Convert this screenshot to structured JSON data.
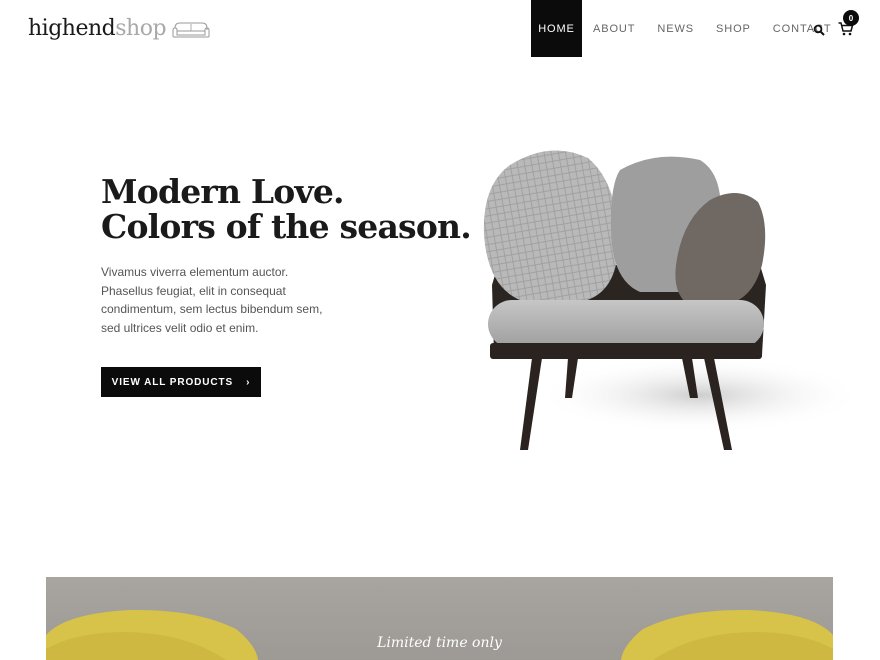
{
  "logo": {
    "part1": "highend",
    "part2": "shop",
    "icon": "sofa-outline-icon"
  },
  "nav": {
    "items": [
      {
        "label": "HOME",
        "active": true
      },
      {
        "label": "ABOUT",
        "active": false
      },
      {
        "label": "NEWS",
        "active": false
      },
      {
        "label": "SHOP",
        "active": false
      },
      {
        "label": "CONTACT",
        "active": false
      }
    ],
    "search_icon": "search-icon",
    "cart_icon": "cart-icon",
    "cart_count": "0"
  },
  "hero": {
    "title_line1": "Modern Love.",
    "title_line2": "Colors of the season.",
    "desc_lines": [
      "Vivamus viverra elementum auctor.",
      "Phasellus feugiat, elit in consequat",
      "condimentum, sem lectus bibendum sem,",
      "sed ultrices velit odio et enim."
    ],
    "cta_label": "VIEW ALL PRODUCTS",
    "cta_icon": "chevron-right-icon"
  },
  "promo": {
    "label": "Limited time only"
  },
  "colors": {
    "accent_dark": "#0b0b0b",
    "logo_grey": "#a9a9a9",
    "promo_bg": "#a39f9a",
    "chair_yellow": "#d7c24a"
  }
}
